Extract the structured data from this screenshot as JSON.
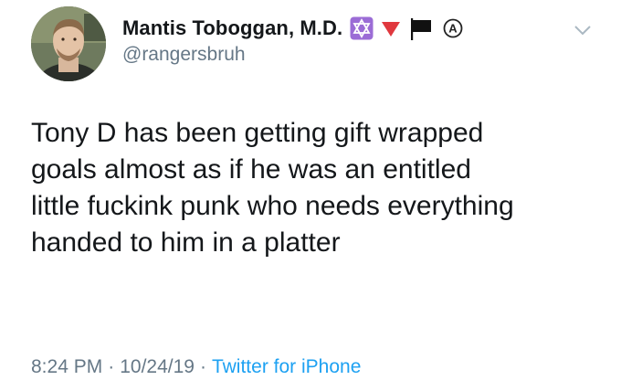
{
  "author": {
    "display_name": "Mantis Toboggan, M.D.",
    "handle": "@rangersbruh",
    "name_emojis": [
      "star-of-david-icon",
      "red-triangle-down-icon",
      "black-flag-icon",
      "circled-a-icon"
    ],
    "colors": {
      "star_box": "#9b6cd6",
      "triangle": "#e0383e",
      "flag": "#111111",
      "circled_a": "#222222"
    }
  },
  "tweet": {
    "text": "Tony D has been getting gift wrapped\ngoals almost as if he was an entitled\nlittle fuckink punk who needs everything\nhanded to him in a platter"
  },
  "meta": {
    "time": "8:24 PM",
    "separator_1": "·",
    "date": "10/24/19",
    "separator_2": "·",
    "source": "Twitter for iPhone"
  },
  "colors": {
    "text": "#14171a",
    "secondary": "#657786",
    "link": "#1da1f2"
  }
}
